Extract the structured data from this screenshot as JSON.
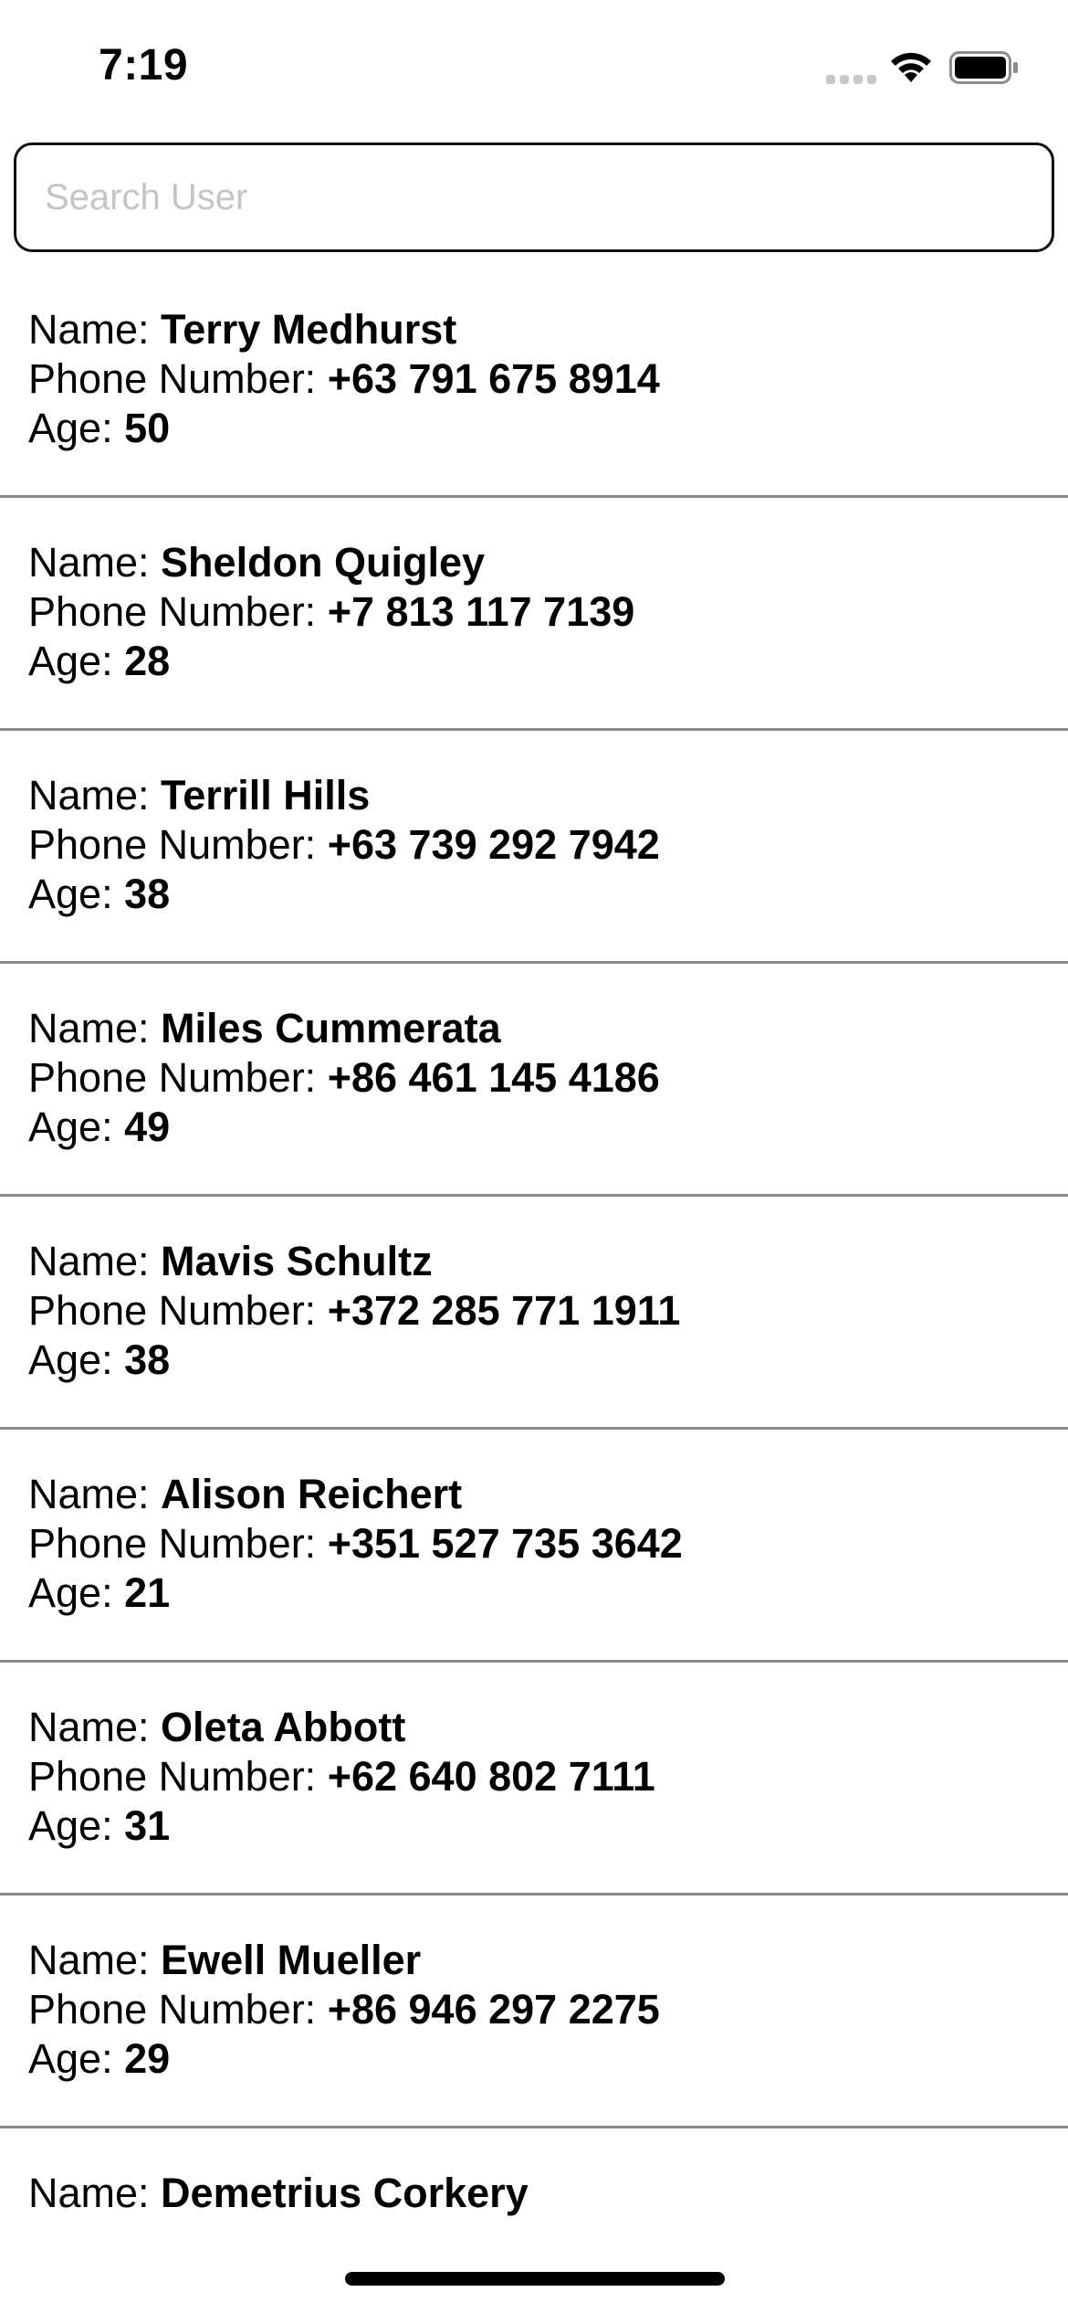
{
  "status_bar": {
    "time": "7:19",
    "icons": [
      "signal-icon",
      "wifi-icon",
      "battery-icon"
    ]
  },
  "search": {
    "placeholder": "Search User",
    "value": ""
  },
  "labels": {
    "name": "Name: ",
    "phone": "Phone Number: ",
    "age": "Age: "
  },
  "users": [
    {
      "name": "Terry Medhurst",
      "phone": "+63 791 675 8914",
      "age": "50"
    },
    {
      "name": "Sheldon Quigley",
      "phone": "+7 813 117 7139",
      "age": "28"
    },
    {
      "name": "Terrill Hills",
      "phone": "+63 739 292 7942",
      "age": "38"
    },
    {
      "name": "Miles Cummerata",
      "phone": "+86 461 145 4186",
      "age": "49"
    },
    {
      "name": "Mavis Schultz",
      "phone": "+372 285 771 1911",
      "age": "38"
    },
    {
      "name": "Alison Reichert",
      "phone": "+351 527 735 3642",
      "age": "21"
    },
    {
      "name": "Oleta Abbott",
      "phone": "+62 640 802 7111",
      "age": "31"
    },
    {
      "name": "Ewell Mueller",
      "phone": "+86 946 297 2275",
      "age": "29"
    },
    {
      "name": "Demetrius Corkery",
      "phone": "",
      "age": ""
    }
  ]
}
